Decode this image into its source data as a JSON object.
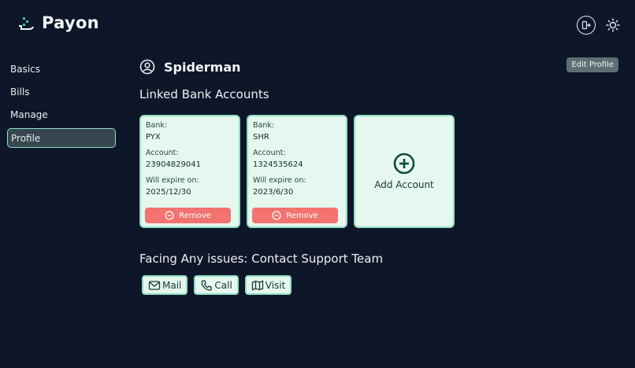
{
  "app": {
    "name": "Payon"
  },
  "sidebar": {
    "items": [
      {
        "label": "Basics"
      },
      {
        "label": "Bills"
      },
      {
        "label": "Manage"
      },
      {
        "label": "Profile",
        "active": true
      }
    ]
  },
  "profile": {
    "username": "Spiderman",
    "edit_label": "Edit Profile"
  },
  "linked": {
    "title": "Linked Bank Accounts",
    "bank_label": "Bank:",
    "account_label": "Account:",
    "expire_label": "Will expire on:",
    "remove_label": "Remove",
    "accounts": [
      {
        "bank": "PYX",
        "account": "23904829041",
        "expires": "2025/12/30"
      },
      {
        "bank": "SHR",
        "account": "1324535624",
        "expires": "2023/6/30"
      }
    ],
    "add_label": "Add Account"
  },
  "support": {
    "title": "Facing Any issues: Contact Support Team",
    "mail_label": "Mail",
    "call_label": "Call",
    "visit_label": "Visit"
  },
  "colors": {
    "background": "#0e1629",
    "card": "#e6f7f0",
    "card_border": "#8fdfc0",
    "remove": "#f2736f",
    "accent": "#1a9e6a"
  }
}
